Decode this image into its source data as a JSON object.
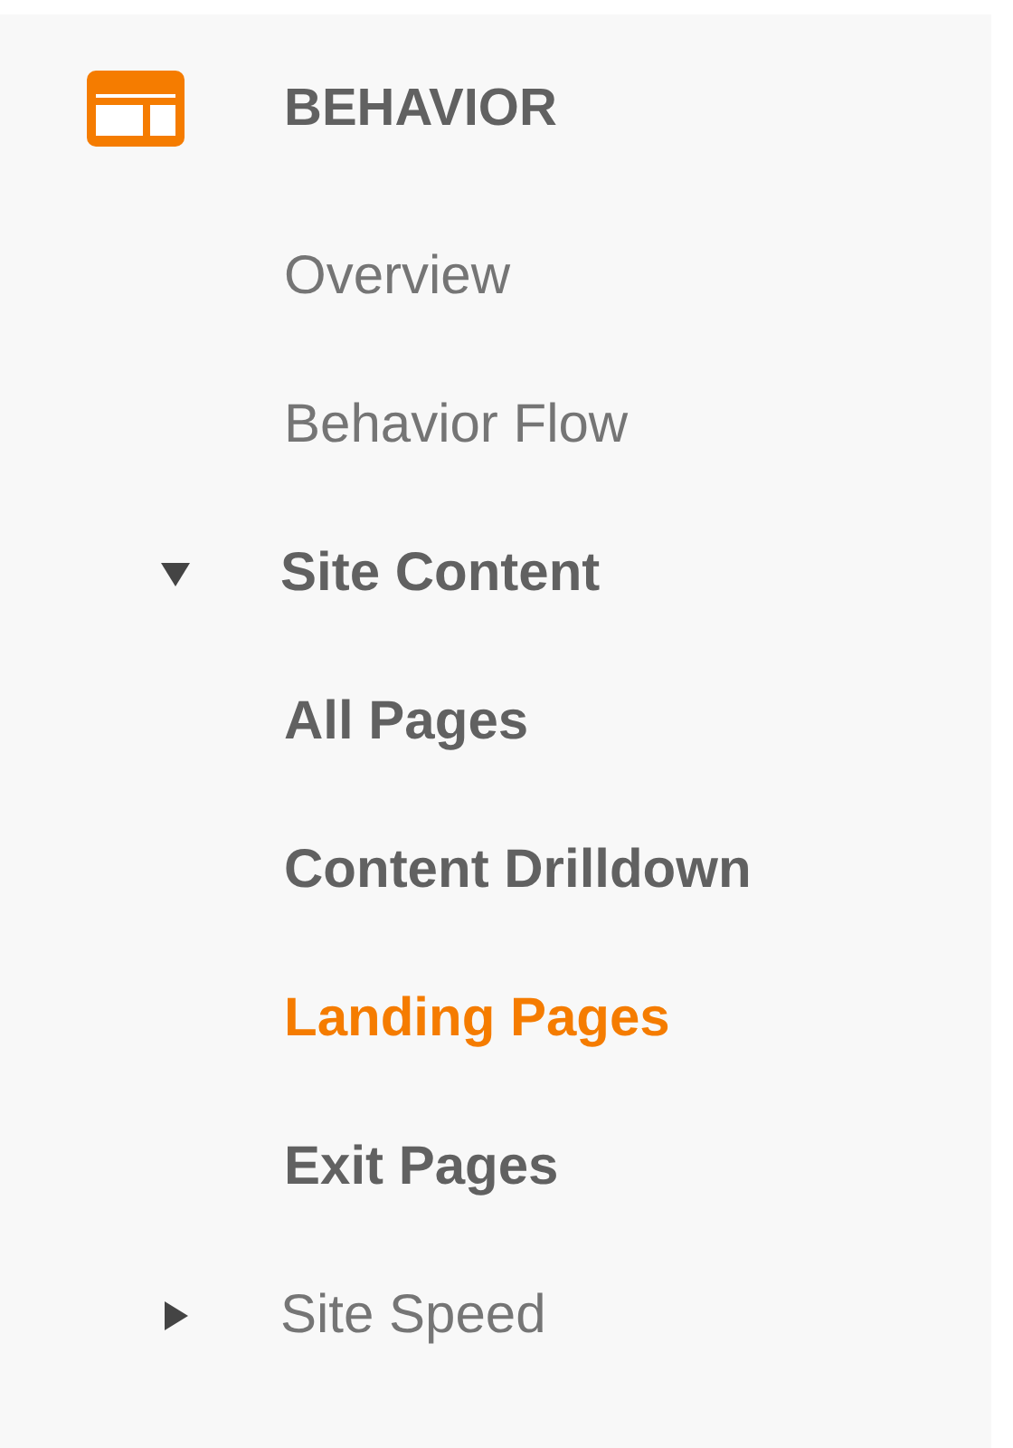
{
  "header": {
    "title": "BEHAVIOR"
  },
  "items": [
    {
      "kind": "link",
      "label": "Overview",
      "selected": false
    },
    {
      "kind": "link",
      "label": "Behavior Flow",
      "selected": false
    },
    {
      "kind": "group",
      "label": "Site Content",
      "expanded": true,
      "children": [
        {
          "kind": "link",
          "label": "All Pages",
          "selected": false
        },
        {
          "kind": "link",
          "label": "Content Drilldown",
          "selected": false
        },
        {
          "kind": "link",
          "label": "Landing Pages",
          "selected": true
        },
        {
          "kind": "link",
          "label": "Exit Pages",
          "selected": false
        }
      ]
    },
    {
      "kind": "group",
      "label": "Site Speed",
      "expanded": false
    }
  ]
}
